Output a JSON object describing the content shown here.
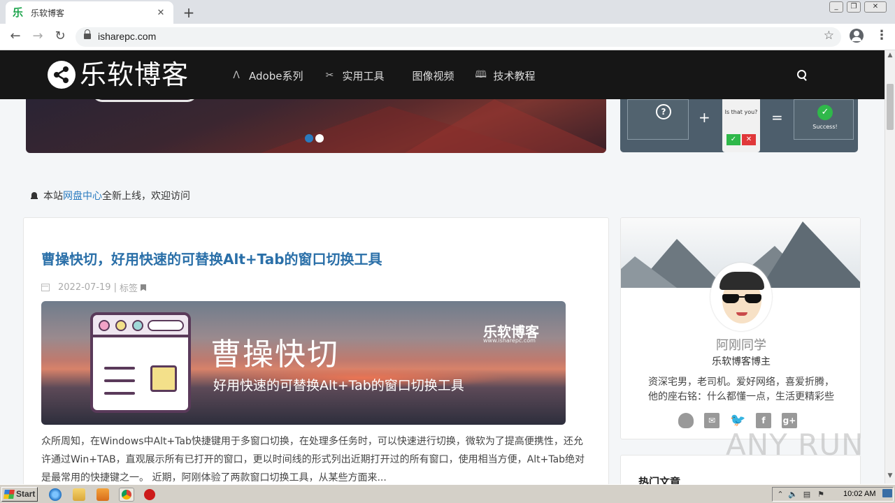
{
  "browser": {
    "tab_title": "乐软博客",
    "tab_favicon": "乐",
    "url": "isharepc.com",
    "new_tab_glyph": "+",
    "close_glyph": "✕"
  },
  "site": {
    "logo_text": "乐软博客",
    "nav": [
      {
        "label": "Adobe系列",
        "icon": "adobe-icon",
        "glyph": "Λ"
      },
      {
        "label": "实用工具",
        "icon": "tools-icon",
        "glyph": "✂"
      },
      {
        "label": "图像视频",
        "icon": "image-icon",
        "glyph": ""
      },
      {
        "label": "技术教程",
        "icon": "book-icon",
        "glyph": "🕮"
      }
    ]
  },
  "banner": {
    "captcha": {
      "question": "?",
      "plus": "+",
      "equals": "=",
      "phone_text": "Is that you?",
      "success": "Success!",
      "check": "✓",
      "cross": "✕"
    }
  },
  "notice": {
    "prefix": "本站",
    "link": "网盘中心",
    "suffix": "全新上线，欢迎访问"
  },
  "article": {
    "title": "曹操快切，好用快速的可替换Alt+Tab的窗口切换工具",
    "date": "2022-07-19",
    "separator": "|",
    "tag_label": "标签",
    "image_title": "曹操快切",
    "image_subtitle": "好用快速的可替换Alt+Tab的窗口切换工具",
    "image_logo": "乐软博客",
    "image_logo_url": "www.isharepc.com",
    "excerpt": "众所周知，在Windows中Alt+Tab快捷键用于多窗口切换，在处理多任务时，可以快速进行切换，微软为了提高便携性，还允许通过Win+TAB，直观展示所有已打开的窗口，更以时间线的形式列出近期打开过的所有窗口，使用相当方便，Alt+Tab绝对是最常用的快捷键之一。 近期，阿刚体验了两款窗口切换工具，从某些方面来..."
  },
  "profile": {
    "name": "阿刚同学",
    "role": "乐软博客博主",
    "bio_line1": "资深宅男，老司机。爱好网络，喜爱折腾，",
    "bio_line2": "他的座右铭：什么都懂一点，生活更精彩些",
    "socials": [
      {
        "name": "qq-icon",
        "color": "#999999",
        "glyph": "🐧"
      },
      {
        "name": "email-icon",
        "color": "#999999",
        "glyph": "✉"
      },
      {
        "name": "twitter-icon",
        "color": "#999999",
        "glyph": "🐦"
      },
      {
        "name": "facebook-icon",
        "color": "#999999",
        "glyph": "f"
      },
      {
        "name": "google-plus-icon",
        "color": "#999999",
        "glyph": "g+"
      }
    ]
  },
  "hot": {
    "title": "热门文章"
  },
  "watermark": "ANY RUN",
  "taskbar": {
    "start_label": "Start",
    "clock": "10:02 AM"
  },
  "colors": {
    "link": "#2a7bbf",
    "header_bg": "#161616",
    "slider_dot_active": "#2a7bbf"
  }
}
